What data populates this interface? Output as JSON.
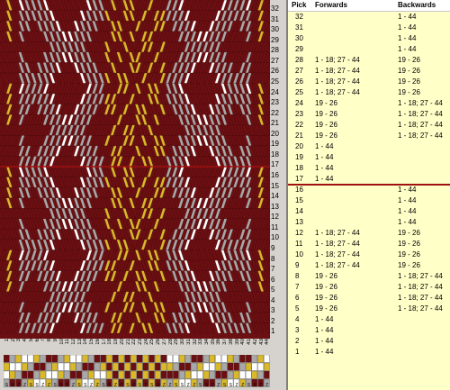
{
  "pattern": {
    "num_cards": 44,
    "num_picks": 32,
    "colors": {
      "maroon": "#6b0f12",
      "gold": "#d9b82a",
      "grey": "#a8a8a8",
      "white": "#ffffff",
      "divider": "#a01010"
    },
    "row_labels": [
      "32",
      "31",
      "30",
      "29",
      "28",
      "27",
      "26",
      "25",
      "24",
      "23",
      "22",
      "21",
      "20",
      "19",
      "18",
      "17",
      "16",
      "15",
      "14",
      "13",
      "12",
      "11",
      "10",
      "9",
      "8",
      "7",
      "6",
      "5",
      "4",
      "3",
      "2",
      "1"
    ],
    "card_labels": [
      "1",
      "2",
      "3",
      "4",
      "5",
      "6",
      "7",
      "8",
      "9",
      "10",
      "11",
      "12",
      "13",
      "14",
      "15",
      "16",
      "17",
      "18",
      "19",
      "20",
      "21",
      "22",
      "23",
      "24",
      "25",
      "26",
      "27",
      "28",
      "29",
      "30",
      "31",
      "32",
      "33",
      "34",
      "35",
      "36",
      "37",
      "38",
      "39",
      "40",
      "41",
      "42",
      "43",
      "44"
    ],
    "threading_directions": [
      "S",
      "S",
      "Z",
      "Z",
      "S",
      "S",
      "Z",
      "Z",
      "S",
      "S",
      "Z",
      "Z",
      "S",
      "S",
      "Z",
      "Z",
      "S",
      "S",
      "Z",
      "Z",
      "S",
      "Z",
      "S",
      "Z",
      "S",
      "S",
      "Z",
      "Z",
      "S",
      "S",
      "Z",
      "Z",
      "S",
      "S",
      "Z",
      "Z",
      "S",
      "S",
      "Z",
      "Z",
      "S",
      "S",
      "Z",
      "Z"
    ]
  },
  "table": {
    "headers": {
      "pick": "Pick",
      "forwards": "Forwards",
      "backwards": "Backwards"
    },
    "current_pick": "17",
    "rows": [
      {
        "pick": "32",
        "forwards": "",
        "backwards": "1 - 44"
      },
      {
        "pick": "31",
        "forwards": "",
        "backwards": "1 - 44"
      },
      {
        "pick": "30",
        "forwards": "",
        "backwards": "1 - 44"
      },
      {
        "pick": "29",
        "forwards": "",
        "backwards": "1 - 44"
      },
      {
        "pick": "28",
        "forwards": "1 - 18; 27 - 44",
        "backwards": "19 - 26"
      },
      {
        "pick": "27",
        "forwards": "1 - 18; 27 - 44",
        "backwards": "19 - 26"
      },
      {
        "pick": "26",
        "forwards": "1 - 18; 27 - 44",
        "backwards": "19 - 26"
      },
      {
        "pick": "25",
        "forwards": "1 - 18; 27 - 44",
        "backwards": "19 - 26"
      },
      {
        "pick": "24",
        "forwards": "19 - 26",
        "backwards": "1 - 18; 27 - 44"
      },
      {
        "pick": "23",
        "forwards": "19 - 26",
        "backwards": "1 - 18; 27 - 44"
      },
      {
        "pick": "22",
        "forwards": "19 - 26",
        "backwards": "1 - 18; 27 - 44"
      },
      {
        "pick": "21",
        "forwards": "19 - 26",
        "backwards": "1 - 18; 27 - 44"
      },
      {
        "pick": "20",
        "forwards": "1 - 44",
        "backwards": ""
      },
      {
        "pick": "19",
        "forwards": "1 - 44",
        "backwards": ""
      },
      {
        "pick": "18",
        "forwards": "1 - 44",
        "backwards": ""
      },
      {
        "pick": "17",
        "forwards": "1 - 44",
        "backwards": ""
      },
      {
        "pick": "16",
        "forwards": "",
        "backwards": "1 - 44"
      },
      {
        "pick": "15",
        "forwards": "",
        "backwards": "1 - 44"
      },
      {
        "pick": "14",
        "forwards": "",
        "backwards": "1 - 44"
      },
      {
        "pick": "13",
        "forwards": "",
        "backwards": "1 - 44"
      },
      {
        "pick": "12",
        "forwards": "1 - 18; 27 - 44",
        "backwards": "19 - 26"
      },
      {
        "pick": "11",
        "forwards": "1 - 18; 27 - 44",
        "backwards": "19 - 26"
      },
      {
        "pick": "10",
        "forwards": "1 - 18; 27 - 44",
        "backwards": "19 - 26"
      },
      {
        "pick": "9",
        "forwards": "1 - 18; 27 - 44",
        "backwards": "19 - 26"
      },
      {
        "pick": "8",
        "forwards": "19 - 26",
        "backwards": "1 - 18; 27 - 44"
      },
      {
        "pick": "7",
        "forwards": "19 - 26",
        "backwards": "1 - 18; 27 - 44"
      },
      {
        "pick": "6",
        "forwards": "19 - 26",
        "backwards": "1 - 18; 27 - 44"
      },
      {
        "pick": "5",
        "forwards": "19 - 26",
        "backwards": "1 - 18; 27 - 44"
      },
      {
        "pick": "4",
        "forwards": "1 - 44",
        "backwards": ""
      },
      {
        "pick": "3",
        "forwards": "1 - 44",
        "backwards": ""
      },
      {
        "pick": "2",
        "forwards": "1 - 44",
        "backwards": ""
      },
      {
        "pick": "1",
        "forwards": "1 - 44",
        "backwards": ""
      }
    ]
  }
}
